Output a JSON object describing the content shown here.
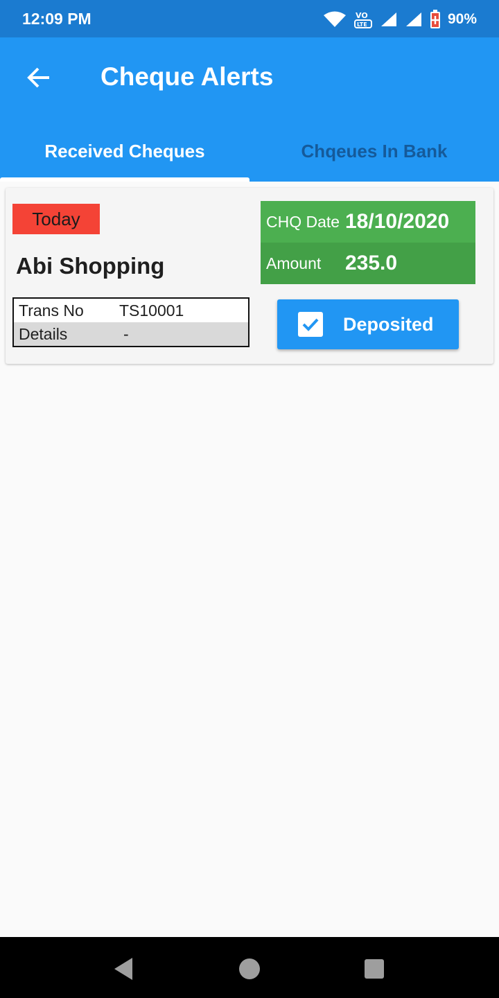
{
  "status_bar": {
    "time": "12:09 PM",
    "battery": "90%",
    "icons": [
      "wifi-icon",
      "volte-icon",
      "signal-icon",
      "signal-icon",
      "battery-icon"
    ]
  },
  "app_bar": {
    "title": "Cheque Alerts",
    "back_icon": "arrow-back-icon",
    "color": "#2196f3"
  },
  "tabs": [
    {
      "label": "Received Cheques",
      "selected": true
    },
    {
      "label": "Chqeues In Bank",
      "selected": false
    }
  ],
  "cheques": [
    {
      "badge": "Today",
      "badge_color": "#f44336",
      "customer": "Abi Shopping",
      "trans_no_label": "Trans No",
      "trans_no": "TS10001",
      "details_label": "Details",
      "details": "-",
      "date_label": "CHQ Date",
      "date": "18/10/2020",
      "amount_label": "Amount",
      "amount": "235.0",
      "status_button": "Deposited",
      "deposited": true
    }
  ],
  "nav_bar": {
    "buttons": [
      "back-triangle-icon",
      "home-circle-icon",
      "recents-square-icon"
    ]
  }
}
